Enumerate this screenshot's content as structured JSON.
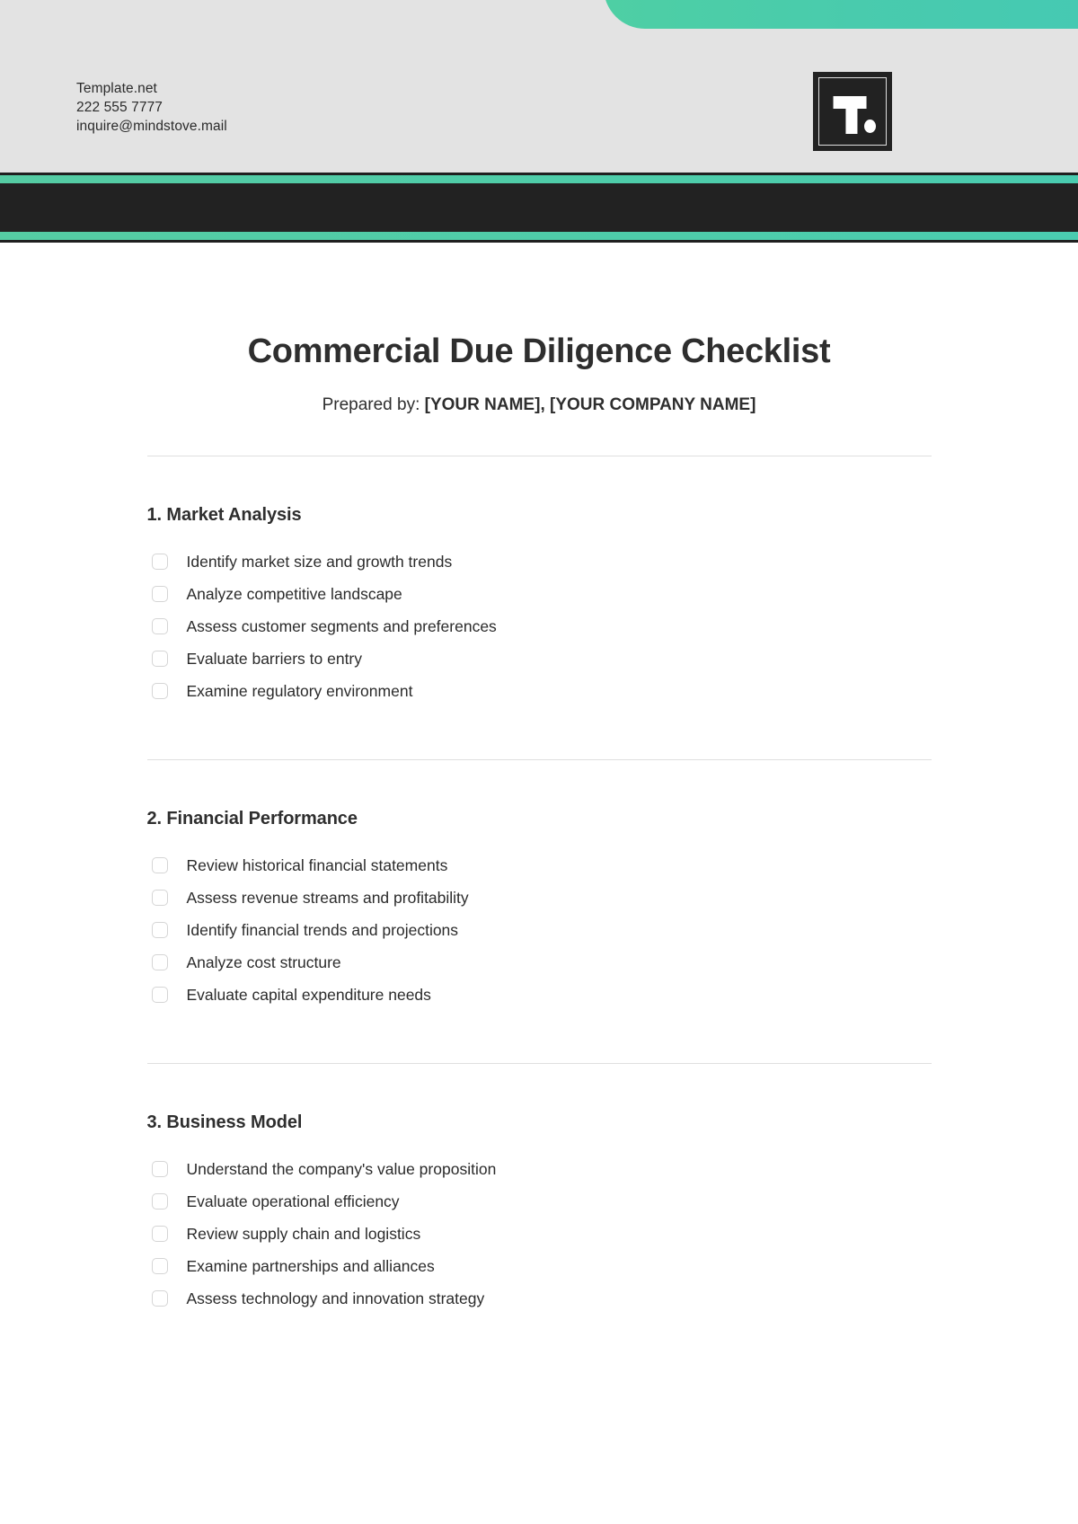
{
  "header": {
    "contact_lines": [
      "Template.net",
      "222 555 7777",
      "inquire@mindstove.mail"
    ],
    "logo_text": "T.",
    "accent_green": "#4ecdaa",
    "band_dark": "#222222",
    "header_bg": "#e3e3e3"
  },
  "document": {
    "title": "Commercial Due Diligence Checklist",
    "prepared_by_label": "Prepared by:",
    "prepared_by_name": "[YOUR NAME]",
    "prepared_by_separator": ",",
    "prepared_by_company": "[YOUR COMPANY NAME]"
  },
  "sections": [
    {
      "heading": "1. Market Analysis",
      "items": [
        "Identify market size and growth trends",
        "Analyze competitive landscape",
        "Assess customer segments and preferences",
        "Evaluate barriers to entry",
        "Examine regulatory environment"
      ]
    },
    {
      "heading": "2. Financial Performance",
      "items": [
        "Review historical financial statements",
        "Assess revenue streams and profitability",
        "Identify financial trends and projections",
        "Analyze cost structure",
        "Evaluate capital expenditure needs"
      ]
    },
    {
      "heading": "3. Business Model",
      "items": [
        "Understand the company's value proposition",
        "Evaluate operational efficiency",
        "Review supply chain and logistics",
        "Examine partnerships and alliances",
        "Assess technology and innovation strategy"
      ]
    }
  ]
}
